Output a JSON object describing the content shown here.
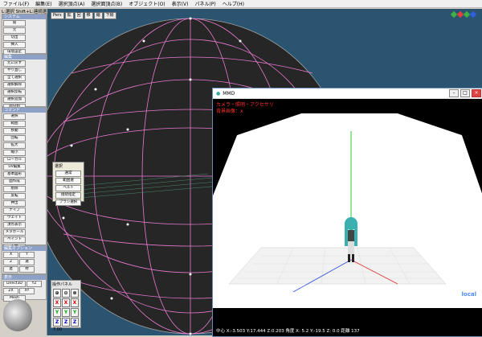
{
  "menu": [
    "ファイル(F)",
    "編集(E)",
    "選択頂点(A)",
    "選択面頂点(B)",
    "オブジェクト(O)",
    "表示(V)",
    "パネル(P)",
    "ヘルプ(H)"
  ],
  "hint": "L:選択 Shift+L:連続選択",
  "left_panel": {
    "system_header": "システム",
    "system_buttons": [
      "開",
      "元",
      "切出",
      "挿入",
      "環境設定",
      "初期設定",
      "物理材質",
      "材質設定"
    ],
    "edit_header": "編集",
    "edit_buttons": [
      "元に戻す",
      "やり直し",
      "全て選択",
      "選択解除",
      "選択反転",
      "選択追加",
      "面分割",
      "頂点削除"
    ],
    "command_header": "コマンド",
    "command_buttons": [
      "選択",
      "範囲",
      "移動",
      "回転",
      "拡大",
      "縮小",
      "ローカル",
      "UV編集",
      "基本図形",
      "面作成",
      "削除",
      "反転",
      "押出",
      "ナイフ",
      "ウェイト",
      "頂点表示",
      "メタボール",
      "ペイント",
      "下絵",
      "ボーン",
      "頂点スナップ"
    ],
    "edit_option_header": "編集オプション",
    "edit_option_buttons": [
      "X",
      "Y",
      "Z",
      "選",
      "連",
      "材",
      "接"
    ],
    "display_header": "表示",
    "display_buttons": [
      "Direct3D",
      "YZ",
      "ZX",
      "XY",
      "Mesh"
    ]
  },
  "viewport": {
    "toolbar": [
      "Pers",
      "拡",
      "回",
      "移",
      "縮",
      "下絵"
    ],
    "mesh_color": "#e87ad0"
  },
  "select_popup": {
    "title": "選択",
    "buttons": [
      "通常",
      "範囲選",
      "ベルト",
      "接続指定",
      "ブラシ選択"
    ]
  },
  "operation_panel": {
    "title": "操作パネル",
    "cells": [
      "⊕",
      "⊙",
      "⊗",
      "X",
      "X",
      "X",
      "Y",
      "Y",
      "Y",
      "Z",
      "Z",
      "Z"
    ],
    "footer": "7.00"
  },
  "mmd_window": {
    "title": "MMD",
    "camera_label": "カメラ・照明・アクセサリ",
    "bg_label": "背景画像：x",
    "status": "中心 X:-3.503 Y:17.444 Z:0.203  角度 X: 5.2 Y:-19.5 Z: 0.0  距離 137",
    "local_label": "local"
  }
}
